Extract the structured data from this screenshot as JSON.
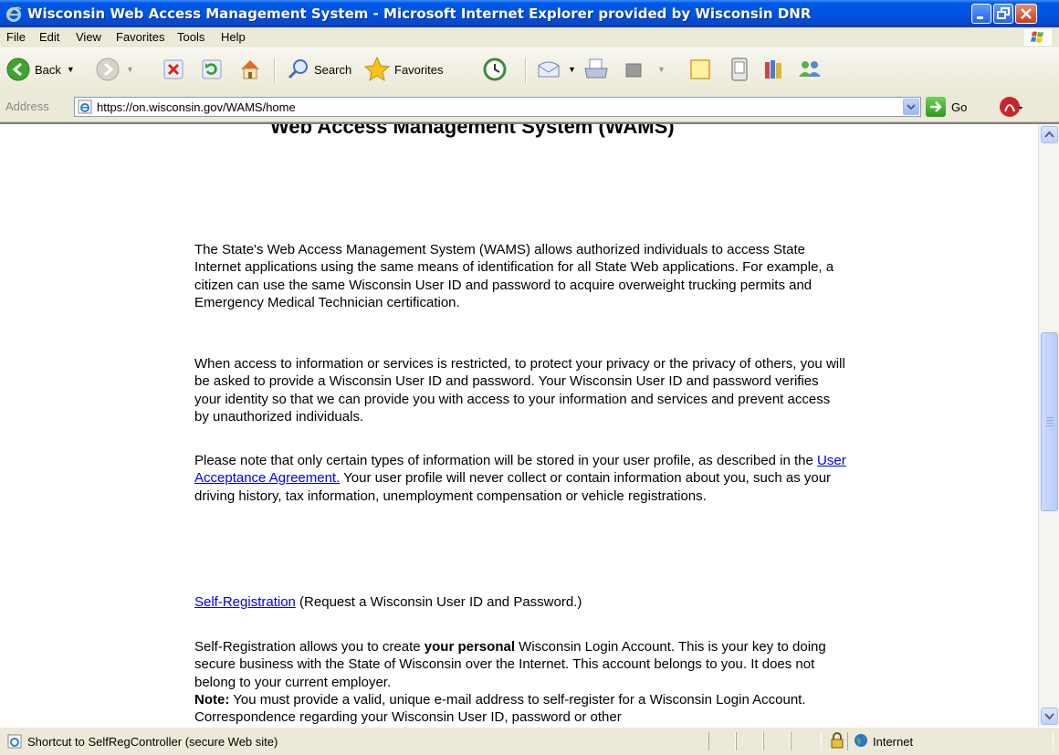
{
  "window": {
    "title": "Wisconsin Web Access Management System - Microsoft Internet Explorer provided by Wisconsin DNR",
    "controls": [
      "minimize",
      "restore",
      "close"
    ]
  },
  "menu": [
    "File",
    "Edit",
    "View",
    "Favorites",
    "Tools",
    "Help"
  ],
  "toolbar": {
    "back_label": "Back",
    "search_label": "Search",
    "favorites_label": "Favorites"
  },
  "address": {
    "label": "Address",
    "url": "https://on.wisconsin.gov/WAMS/home",
    "go_label": "Go"
  },
  "page": {
    "heading": "Web Access Management System (WAMS)",
    "p1": "The State's Web Access Management System (WAMS) allows authorized individuals to access State Internet applications using the same means of identification for all State Web applications.  For example, a citizen can use the same Wisconsin User ID and password to acquire overweight trucking permits and Emergency Medical Technician certification.",
    "p2": "When access to information or services is restricted, to protect your privacy or the privacy of others, you will be asked to provide a Wisconsin User ID and password.  Your Wisconsin User ID and password verifies your identity so that we can provide you with access to your information and services and prevent access by unauthorized individuals.",
    "p3_before": "Please note that only certain types of information will be stored in your user profile, as described in the ",
    "p3_link": "User Acceptance Agreement.",
    "p3_after": " Your user profile will never collect or contain information about you, such as your driving history, tax information, unemployment compensation or vehicle registrations.",
    "selfreg_link": "Self-Registration",
    "selfreg_note": " (Request a Wisconsin User ID and Password.)",
    "p5_before": "Self-Registration allows you to create ",
    "p5_bold": "your personal",
    "p5_after": " Wisconsin Login Account.  This is your key to doing secure business with the State of Wisconsin over the Internet.  This account belongs to you.  It does not belong to your current employer.",
    "note_label": "Note:",
    "note_text": " You must provide a valid, unique e-mail address to self-register for a Wisconsin Login Account. Correspondence regarding your Wisconsin User ID, password or other"
  },
  "status": {
    "text": "Shortcut to SelfRegController (secure Web site)",
    "zone": "Internet"
  },
  "colors": {
    "titlebar": "#0054E3",
    "link": "#0000EE",
    "chrome": "#ECE9D8"
  }
}
